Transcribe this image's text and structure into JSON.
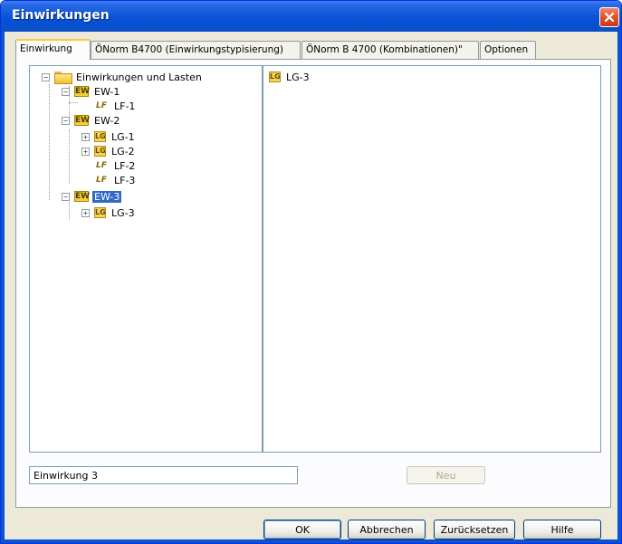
{
  "window": {
    "title": "Einwirkungen"
  },
  "tabs": [
    {
      "label": "Einwirkung",
      "active": true
    },
    {
      "label": "ÖNorm B4700 (Einwirkungstypisierung)",
      "active": false
    },
    {
      "label": "ÖNorm B 4700 (Kombinationen)\"",
      "active": false
    },
    {
      "label": "Optionen",
      "active": false
    }
  ],
  "tree": {
    "root": "Einwirkungen und Lasten",
    "nodes": [
      {
        "label": "EW-1",
        "icon": "EW",
        "expander": "−"
      },
      {
        "label": "LF-1",
        "icon": "LF"
      },
      {
        "label": "EW-2",
        "icon": "EW",
        "expander": "−"
      },
      {
        "label": "LG-1",
        "icon": "LG",
        "expander": "+"
      },
      {
        "label": "LG-2",
        "icon": "LG",
        "expander": "+"
      },
      {
        "label": "LF-2",
        "icon": "LF"
      },
      {
        "label": "LF-3",
        "icon": "LF"
      },
      {
        "label": "EW-3",
        "icon": "EW",
        "expander": "−",
        "selected": true
      },
      {
        "label": "LG-3",
        "icon": "LG",
        "expander": "+"
      }
    ]
  },
  "detail_list": [
    {
      "label": "LG-3",
      "icon": "LG"
    }
  ],
  "name_field": {
    "value": "Einwirkung 3"
  },
  "buttons": {
    "new": "Neu",
    "ok": "OK",
    "cancel": "Abbrechen",
    "reset": "Zurücksetzen",
    "help": "Hilfe"
  },
  "icons": {
    "ew": "EW",
    "lg": "LG",
    "lf": "LF",
    "close": "close-icon"
  }
}
